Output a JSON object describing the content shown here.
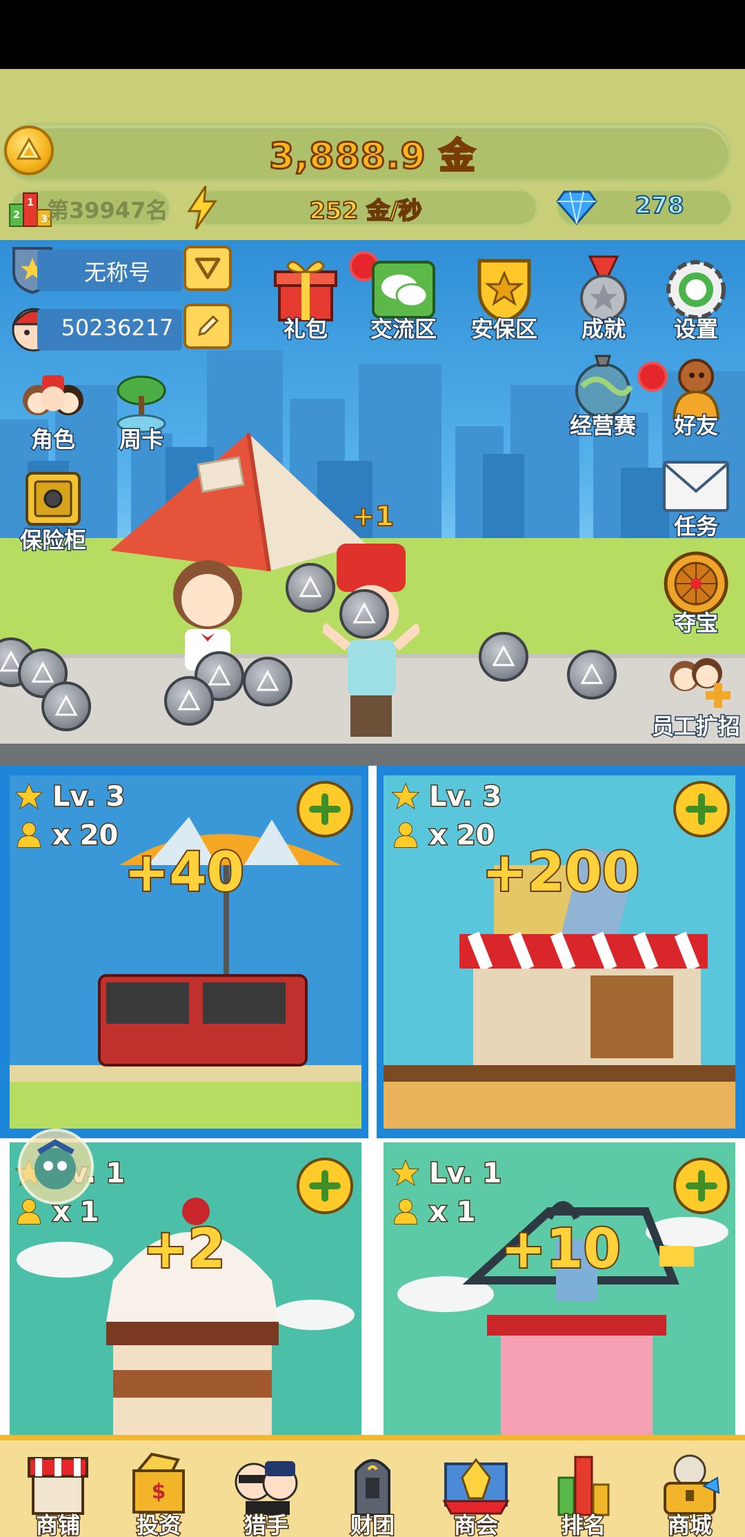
{
  "top": {
    "gold_amount": "3,888.9 金",
    "rank": "第39947名",
    "income_rate": "252 金/秒",
    "diamonds": "278"
  },
  "player": {
    "title": "无称号",
    "id": "50236217"
  },
  "menu_right": {
    "gift": "礼包",
    "chat": "交流区",
    "security": "安保区",
    "achievement": "成就",
    "settings": "设置",
    "business_race": "经营赛",
    "friends": "好友",
    "tasks": "任务",
    "treasure": "夺宝",
    "hire": "员工扩招"
  },
  "menu_left": {
    "role": "角色",
    "weekly_card": "周卡",
    "safe": "保险柜"
  },
  "scene": {
    "plus_one": "+1"
  },
  "shops": [
    {
      "level": "Lv. 3",
      "staff": "x 20",
      "income": "+40",
      "bg": "#3a98d8"
    },
    {
      "level": "Lv. 3",
      "staff": "x 20",
      "income": "+200",
      "bg": "#59c6dc"
    },
    {
      "level": "Lv. 1",
      "staff": "x 1",
      "income": "+2",
      "bg": "#4cbfa8"
    },
    {
      "level": "Lv. 1",
      "staff": "x 1",
      "income": "+10",
      "bg": "#5ccaa6"
    }
  ],
  "bottom_nav": [
    {
      "label": "商铺"
    },
    {
      "label": "投资"
    },
    {
      "label": "猎手"
    },
    {
      "label": "财团"
    },
    {
      "label": "商会"
    },
    {
      "label": "排名"
    },
    {
      "label": "商城"
    }
  ],
  "colors": {
    "accent_gold": "#ffb51e",
    "sky": "#58b3ec",
    "nav_bg": "#f6dd95"
  }
}
